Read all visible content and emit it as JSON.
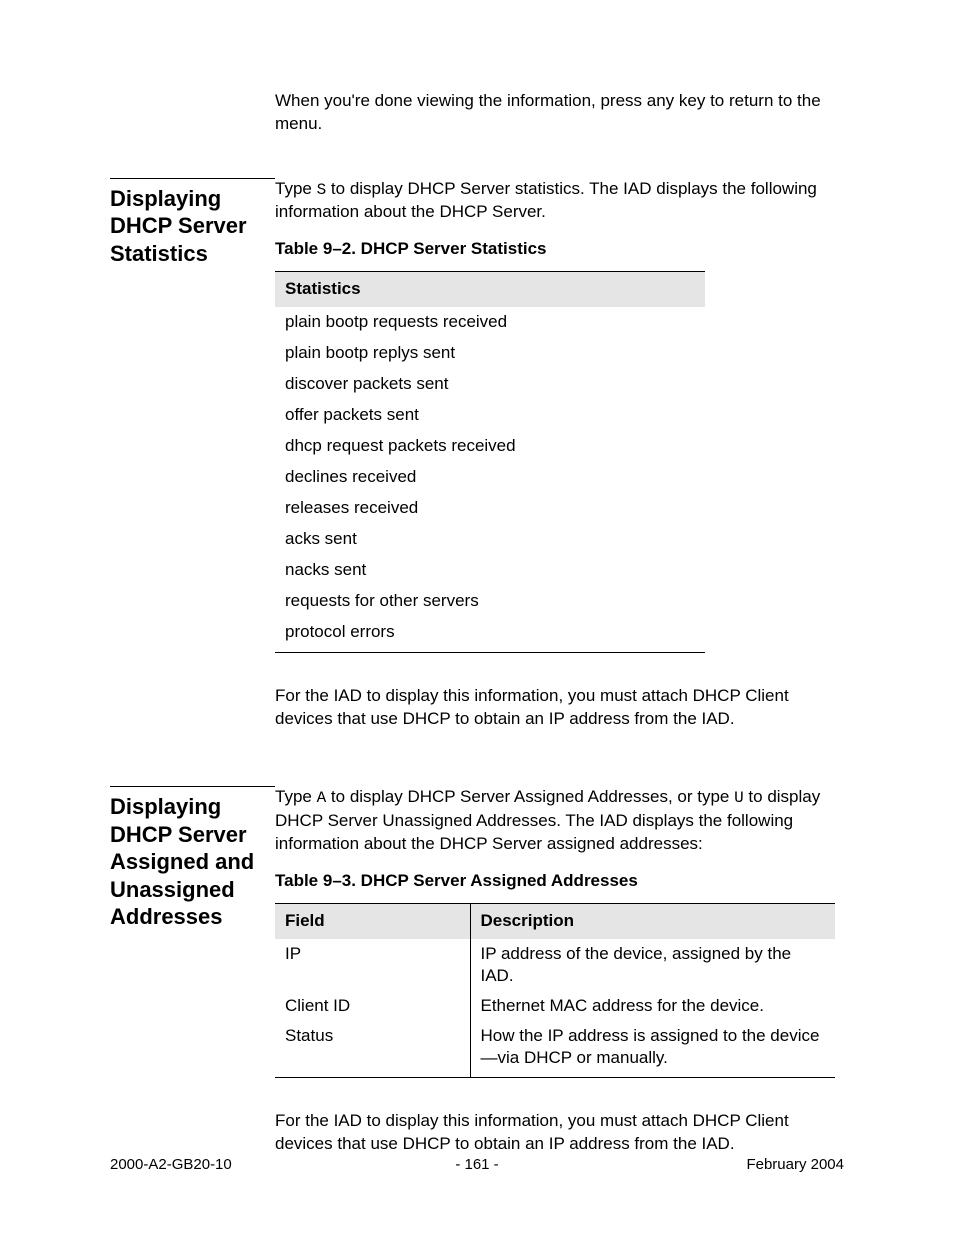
{
  "intro_paragraph": "When you're done viewing the information, press any key to return to the menu.",
  "section1": {
    "heading": "Displaying DHCP Server Sta­tistics",
    "para1_pre": "Type ",
    "para1_key": "S",
    "para1_post": " to display DHCP Server statistics. The IAD displays the following information about the DHCP Server.",
    "table_caption": "Table 9–2.  DHCP Server Statistics",
    "table_header": "Statistics",
    "rows": [
      "plain bootp requests received",
      "plain bootp replys sent",
      "discover packets sent",
      "offer packets sent",
      "dhcp request packets received",
      "declines received",
      "releases received",
      "acks sent",
      "nacks sent",
      "requests for other servers",
      "protocol errors"
    ],
    "para2": "For the IAD to display this information, you must attach DHCP Client devices that use DHCP to obtain an IP address from the IAD."
  },
  "section2": {
    "heading": "Displaying DHCP Server Assigned and Unas­signed Addresses",
    "para1_pre": "Type ",
    "para1_key1": "A",
    "para1_mid": " to display DHCP Server Assigned Addresses, or type ",
    "para1_key2": "U",
    "para1_post": " to display DHCP Server Unassigned Addresses. The IAD displays the following information about the DHCP Server assigned addresses:",
    "table_caption": "Table 9–3.  DHCP Server Assigned Addresses",
    "table_header1": "Field",
    "table_header2": "Description",
    "rows": [
      {
        "field": "IP",
        "desc": "IP address of the device, assigned by the IAD."
      },
      {
        "field": "Client ID",
        "desc": "Ethernet MAC address for the device."
      },
      {
        "field": "Status",
        "desc": "How the IP address is assigned to the device—via DHCP or manually."
      }
    ],
    "para2": "For the IAD to display this information, you must attach DHCP Client devices that use DHCP to obtain an IP address from the IAD."
  },
  "footer": {
    "left": "2000-A2-GB20-10",
    "center": "- 161 -",
    "right": "February 2004"
  }
}
